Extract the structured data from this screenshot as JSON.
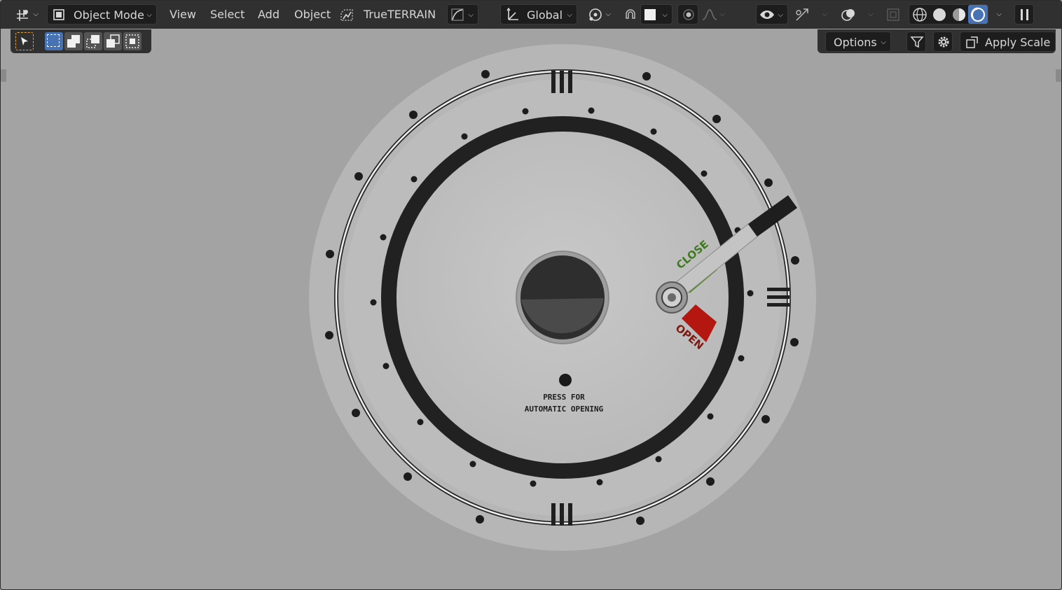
{
  "header": {
    "editor_type_icon": "grid-axes-icon",
    "mode_label": "Object Mode",
    "menus": [
      "View",
      "Select",
      "Add",
      "Object"
    ],
    "addon_label": "TrueTERRAIN",
    "orientation_label": "Global"
  },
  "toolbar": {
    "options_label": "Options",
    "apply_scale_label": "Apply Scale"
  },
  "viewport": {
    "dial_text": {
      "close_label": "CLOSE",
      "open_label": "OPEN",
      "press_line1": "PRESS FOR",
      "press_line2": "AUTOMATIC OPENING"
    }
  },
  "colors": {
    "header_bg": "#303030",
    "viewport_bg": "#a3a3a3",
    "accent_blue": "#4772b3",
    "select_orange": "#e8a73a",
    "close_green": "#3f7a1e",
    "open_red": "#b3170f"
  }
}
